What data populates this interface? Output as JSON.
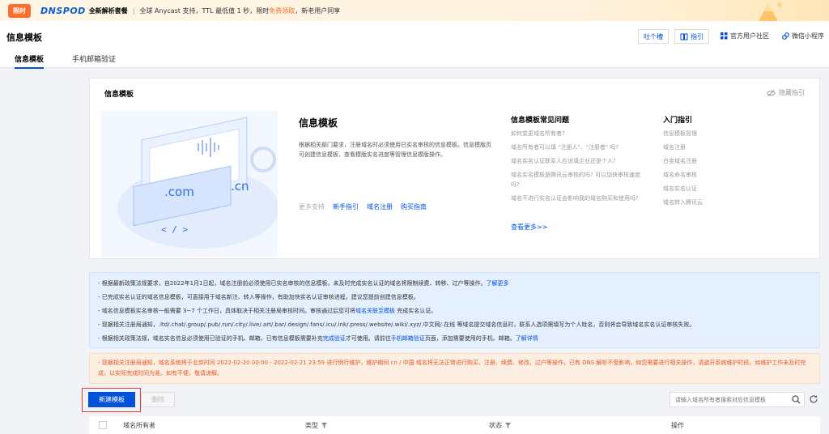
{
  "promo": {
    "tag": "限时",
    "logo": "DNSPOD",
    "title": "全新解析套餐",
    "sep": "|",
    "text": "全球 Anycast 支持，TTL 最低值 1 秒，限时",
    "highlight": "免费领取",
    "text2": "，新老用户同享"
  },
  "header": {
    "title": "信息模板",
    "feedback_btn": "吐个槽",
    "guide_btn": "指引",
    "community_link": "官方用户社区",
    "miniapp_link": "微信小程序",
    "tabs": [
      "信息模板",
      "手机邮箱验证"
    ]
  },
  "guide": {
    "card_title": "信息模板",
    "hide_label": "隐藏指引",
    "intro_title": "信息模板",
    "intro_desc": "根据相关部门要求，注册域名时必须使用已实名审核的信息模板。信息模版页可创建信息模板、查看模版实名进度等管理信息模版操作。",
    "support_label": "更多支持",
    "support_links": [
      "新手指引",
      "域名注册",
      "购买指南"
    ],
    "faq_title": "信息模板常见问题",
    "faq_items": [
      "如何变更域名所有者?",
      "域名所有者可以填 \"注册人\"、\"注册者\" 吗?",
      "域名实名认证联系人应该填企业还是个人?",
      "域名实名模板是腾讯云审核的吗? 可以加快审核速度吗?",
      "域名不进行实名认证会影响我的域名购买和使用吗?"
    ],
    "faq_more": "查看更多>>",
    "entry_title": "入门指引",
    "entry_items": [
      "信息模板管理",
      "域名注册",
      "白金域名注册",
      "域名命名审核",
      "域名实名认证",
      "域名转入腾讯云"
    ],
    "illus_com": ".com",
    "illus_cn": ".cn",
    "illus_code": "< / >"
  },
  "notice": {
    "l1_text": "- 根据最新政策法规要求，自2022年1月1日起，域名注册前必须使用已实名审核的信息模板，未及时完成实名认证的域名将限制续费、转移、过户等操作。",
    "l1_link": "了解更多",
    "l2": "- 已完成实名认证的域名信息模板，可直接用于域名新注、转入等操作，有助加快实名认证审核进程，建议您提前创建信息模板。",
    "l3_text": "- 域名信息模板实名审核一般需要 3~7 个工作日，具体取决于相关注册局审核时间。审核通过后您可将",
    "l3_link": "域名关联至模板",
    "l3_end": "完成实名认证。",
    "l4": "- 现据相关注册局通知，.ltd/.chat/.group/.pub/.run/.city/.live/.art/.bar/.design/.fans/.icu/.ink/.press/.website/.wiki/.xyz/.中文网/.在线 等域名提交域名信息时，联系人选项需填写为个人姓名，否则将会导致域名实名认证审核失败。",
    "l5_text": "- 根据相关政策法规，域名实名信息必须使用已验证的手机、邮箱，已有信息模板需要补充",
    "l5_link1": "完成验证",
    "l5_mid": "才可使用。请前往",
    "l5_link2": "手机邮箱验证",
    "l5_mid2": "页面，添加需要使用的手机、邮箱。",
    "l5_link3": "了解详情",
    "orange": "- 现据相关注册局通知，域名系统将于北京时间 2022-02-20 00:00 - 2022-02-21 23:59 进行例行维护，维护期间 cn / 中国 域名将无法正常进行购买、注册、续费、修改、过户等操作，已有 DNS 解析不受影响。如您需要进行相关操作，请避开系统维护时段。如维护工作未及时完成，以实际完成时间为准。如有不便，敬请谅解。"
  },
  "toolbar": {
    "new_btn": "新建模板",
    "delete_btn": "删除",
    "search_placeholder": "请输入域名所有者搜索对应信息模板"
  },
  "table": {
    "columns": [
      "域名所有者",
      "类型",
      "状态",
      "操作"
    ]
  },
  "colors": {
    "primary": "#0052d9",
    "promo_accent": "#ff6e2a",
    "warn_text": "#e0572a",
    "highlight_border": "#e63b3b"
  }
}
